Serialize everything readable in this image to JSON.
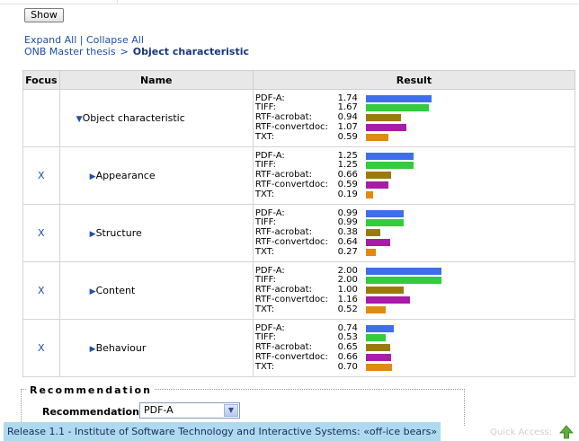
{
  "toolbar": {
    "show_label": "Show"
  },
  "links": {
    "expand_all": "Expand All",
    "separator": "|",
    "collapse_all": "Collapse All"
  },
  "breadcrumb": {
    "root": "ONB Master thesis",
    "sep": ">",
    "current": "Object characteristic"
  },
  "table": {
    "headers": {
      "focus": "Focus",
      "name": "Name",
      "result": "Result"
    },
    "rows": [
      {
        "focus": "",
        "arrow": "▼",
        "name": "Object characteristic",
        "results": [
          {
            "label": "PDF-A:",
            "value": "1.74",
            "num": 1.74,
            "color": "#3f6fe8"
          },
          {
            "label": "TIFF:",
            "value": "1.67",
            "num": 1.67,
            "color": "#32cc3c"
          },
          {
            "label": "RTF-acrobat:",
            "value": "0.94",
            "num": 0.94,
            "color": "#9a7a0c"
          },
          {
            "label": "RTF-convertdoc:",
            "value": "1.07",
            "num": 1.07,
            "color": "#a81ca8"
          },
          {
            "label": "TXT:",
            "value": "0.59",
            "num": 0.59,
            "color": "#e08a12"
          }
        ]
      },
      {
        "focus": "X",
        "arrow": "▶",
        "name": "Appearance",
        "results": [
          {
            "label": "PDF-A:",
            "value": "1.25",
            "num": 1.25,
            "color": "#3f6fe8"
          },
          {
            "label": "TIFF:",
            "value": "1.25",
            "num": 1.25,
            "color": "#32cc3c"
          },
          {
            "label": "RTF-acrobat:",
            "value": "0.66",
            "num": 0.66,
            "color": "#9a7a0c"
          },
          {
            "label": "RTF-convertdoc:",
            "value": "0.59",
            "num": 0.59,
            "color": "#a81ca8"
          },
          {
            "label": "TXT:",
            "value": "0.19",
            "num": 0.19,
            "color": "#e08a12"
          }
        ]
      },
      {
        "focus": "X",
        "arrow": "▶",
        "name": "Structure",
        "results": [
          {
            "label": "PDF-A:",
            "value": "0.99",
            "num": 0.99,
            "color": "#3f6fe8"
          },
          {
            "label": "TIFF:",
            "value": "0.99",
            "num": 0.99,
            "color": "#32cc3c"
          },
          {
            "label": "RTF-acrobat:",
            "value": "0.38",
            "num": 0.38,
            "color": "#9a7a0c"
          },
          {
            "label": "RTF-convertdoc:",
            "value": "0.64",
            "num": 0.64,
            "color": "#a81ca8"
          },
          {
            "label": "TXT:",
            "value": "0.27",
            "num": 0.27,
            "color": "#e08a12"
          }
        ]
      },
      {
        "focus": "X",
        "arrow": "▶",
        "name": "Content",
        "results": [
          {
            "label": "PDF-A:",
            "value": "2.00",
            "num": 2.0,
            "color": "#3f6fe8"
          },
          {
            "label": "TIFF:",
            "value": "2.00",
            "num": 2.0,
            "color": "#32cc3c"
          },
          {
            "label": "RTF-acrobat:",
            "value": "1.00",
            "num": 1.0,
            "color": "#9a7a0c"
          },
          {
            "label": "RTF-convertdoc:",
            "value": "1.16",
            "num": 1.16,
            "color": "#a81ca8"
          },
          {
            "label": "TXT:",
            "value": "0.52",
            "num": 0.52,
            "color": "#e08a12"
          }
        ]
      },
      {
        "focus": "X",
        "arrow": "▶",
        "name": "Behaviour",
        "results": [
          {
            "label": "PDF-A:",
            "value": "0.74",
            "num": 0.74,
            "color": "#3f6fe8"
          },
          {
            "label": "TIFF:",
            "value": "0.53",
            "num": 0.53,
            "color": "#32cc3c"
          },
          {
            "label": "RTF-acrobat:",
            "value": "0.65",
            "num": 0.65,
            "color": "#9a7a0c"
          },
          {
            "label": "RTF-convertdoc:",
            "value": "0.66",
            "num": 0.66,
            "color": "#a81ca8"
          },
          {
            "label": "TXT:",
            "value": "0.70",
            "num": 0.7,
            "color": "#e08a12"
          }
        ]
      }
    ]
  },
  "recommendation": {
    "legend": "Recommendation",
    "label": "Recommendation:",
    "selected": "PDF-A"
  },
  "footer": {
    "text": "Release 1.1 - Institute of Software Technology and Interactive Systems: «off-ice bears»",
    "quick_access": "Quick Access:",
    "up_icon": "up-arrow-icon"
  }
}
